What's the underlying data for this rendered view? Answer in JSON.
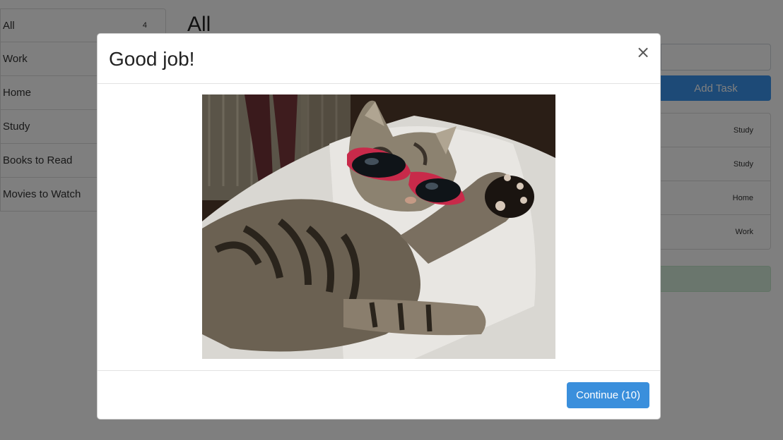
{
  "sidebar": {
    "items": [
      {
        "label": "All",
        "count": "4"
      },
      {
        "label": "Work",
        "count": ""
      },
      {
        "label": "Home",
        "count": ""
      },
      {
        "label": "Study",
        "count": ""
      },
      {
        "label": "Books to Read",
        "count": ""
      },
      {
        "label": "Movies to Watch",
        "count": ""
      }
    ]
  },
  "main": {
    "title": "All",
    "task_input": {
      "placeholder": "",
      "value": ""
    },
    "add_task_label": "Add Task",
    "tasks": [
      {
        "category": "Study"
      },
      {
        "category": "Study"
      },
      {
        "category": "Home"
      },
      {
        "category": "Work"
      }
    ]
  },
  "modal": {
    "title": "Good job!",
    "close_symbol": "×",
    "image": {
      "subject": "tabby cat wearing red sunglasses lying on white blanket"
    },
    "continue_label": "Continue (10)"
  },
  "colors": {
    "primary": "#3a8fdc",
    "success_bg": "#d4edda",
    "backdrop": "rgba(0,0,0,0.5)"
  }
}
